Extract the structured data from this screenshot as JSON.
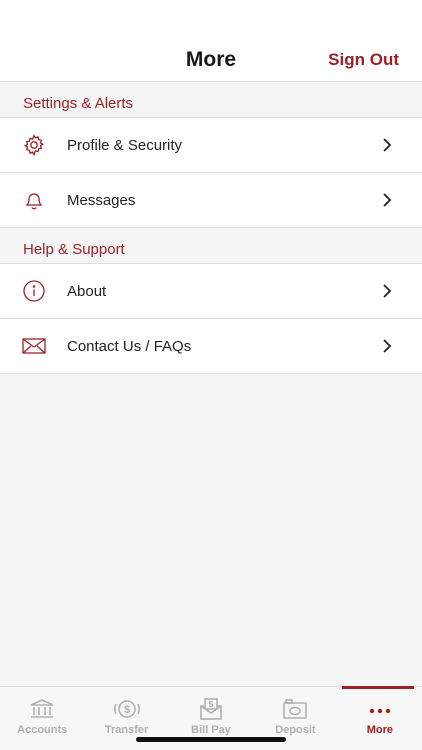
{
  "header": {
    "title": "More",
    "sign_out": "Sign Out"
  },
  "sections": [
    {
      "title": "Settings & Alerts",
      "items": [
        {
          "label": "Profile & Security",
          "icon": "gear-icon"
        },
        {
          "label": "Messages",
          "icon": "bell-icon"
        }
      ]
    },
    {
      "title": "Help & Support",
      "items": [
        {
          "label": "About",
          "icon": "info-icon"
        },
        {
          "label": "Contact Us / FAQs",
          "icon": "envelope-icon"
        }
      ]
    }
  ],
  "tabs": [
    {
      "label": "Accounts",
      "icon": "bank-icon",
      "active": false
    },
    {
      "label": "Transfer",
      "icon": "transfer-icon",
      "active": false
    },
    {
      "label": "Bill Pay",
      "icon": "bill-pay-icon",
      "active": false
    },
    {
      "label": "Deposit",
      "icon": "camera-icon",
      "active": false
    },
    {
      "label": "More",
      "icon": "more-dots-icon",
      "active": true
    }
  ],
  "colors": {
    "accent": "#9b2226",
    "tab_inactive": "#b0b0b0"
  }
}
